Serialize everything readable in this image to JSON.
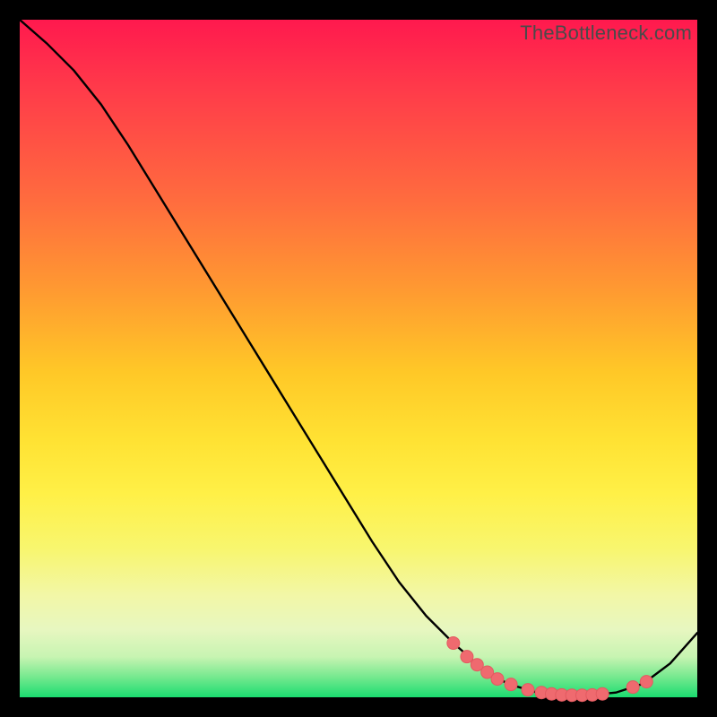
{
  "watermark": "TheBottleneck.com",
  "colors": {
    "black": "#000000",
    "line": "#000000",
    "marker_fill": "#ef6a6f",
    "marker_stroke": "#e35a60"
  },
  "chart_data": {
    "type": "line",
    "title": "",
    "xlabel": "",
    "ylabel": "",
    "xlim": [
      0,
      100
    ],
    "ylim": [
      0,
      100
    ],
    "series": [
      {
        "name": "curve",
        "x": [
          0,
          4,
          8,
          12,
          16,
          20,
          24,
          28,
          32,
          36,
          40,
          44,
          48,
          52,
          56,
          60,
          64,
          68,
          72,
          76,
          80,
          84,
          88,
          92,
          96,
          100
        ],
        "y": [
          100,
          96.5,
          92.5,
          87.5,
          81.5,
          75.0,
          68.5,
          62.0,
          55.5,
          49.0,
          42.5,
          36.0,
          29.5,
          23.0,
          17.0,
          12.0,
          8.0,
          4.5,
          2.0,
          0.8,
          0.3,
          0.3,
          0.7,
          2.0,
          5.0,
          9.5
        ]
      }
    ],
    "markers": [
      {
        "x": 64.0,
        "y": 8.0
      },
      {
        "x": 66.0,
        "y": 6.0
      },
      {
        "x": 67.5,
        "y": 4.8
      },
      {
        "x": 69.0,
        "y": 3.7
      },
      {
        "x": 70.5,
        "y": 2.7
      },
      {
        "x": 72.5,
        "y": 1.9
      },
      {
        "x": 75.0,
        "y": 1.1
      },
      {
        "x": 77.0,
        "y": 0.7
      },
      {
        "x": 78.5,
        "y": 0.5
      },
      {
        "x": 80.0,
        "y": 0.35
      },
      {
        "x": 81.5,
        "y": 0.3
      },
      {
        "x": 83.0,
        "y": 0.3
      },
      {
        "x": 84.5,
        "y": 0.35
      },
      {
        "x": 86.0,
        "y": 0.5
      },
      {
        "x": 90.5,
        "y": 1.5
      },
      {
        "x": 92.5,
        "y": 2.3
      }
    ]
  }
}
